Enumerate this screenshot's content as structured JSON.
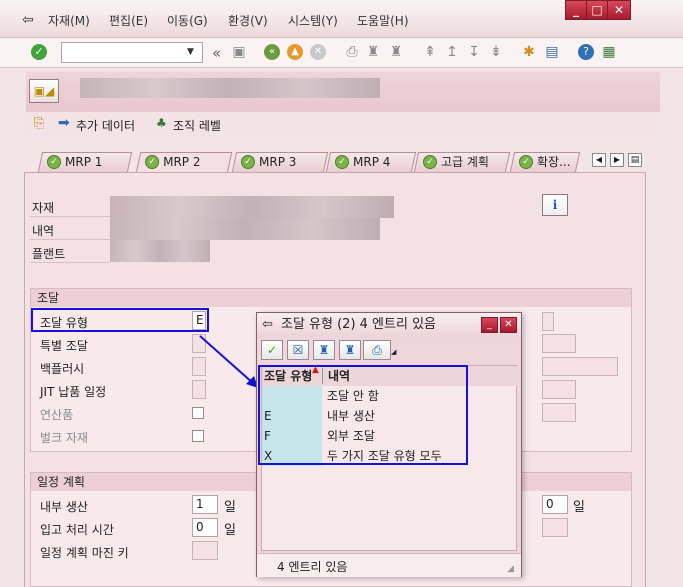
{
  "menubar": {
    "items": [
      "자재(M)",
      "편집(E)",
      "이동(G)",
      "환경(V)",
      "시스템(Y)",
      "도움말(H)"
    ]
  },
  "toolbar": {
    "command_field": "",
    "back_glyph": "«"
  },
  "subtoolbar": {
    "additional_data": "추가 데이터",
    "org_levels": "조직 레벨"
  },
  "tabs": [
    {
      "label": "MRP 1",
      "active": false
    },
    {
      "label": "MRP 2",
      "active": true
    },
    {
      "label": "MRP 3",
      "active": false
    },
    {
      "label": "MRP 4",
      "active": false
    },
    {
      "label": "고급 계획",
      "active": false
    },
    {
      "label": "확장...",
      "active": false
    }
  ],
  "header": {
    "material_label": "자재",
    "description_label": "내역",
    "plant_label": "플랜트"
  },
  "procurement": {
    "title": "조달",
    "procurement_type_label": "조달 유형",
    "procurement_type_value": "E",
    "special_procurement_label": "특별 조달",
    "backflush_label": "백플러시",
    "jit_label": "JIT 납품 일정",
    "coproduct_label": "연산품",
    "bulk_material_label": "벌크 자재"
  },
  "scheduling": {
    "title": "일정 계획",
    "inhouse_production_label": "내부 생산",
    "inhouse_production_value": "1",
    "inhouse_unit": "일",
    "gr_processing_label": "입고 처리 시간",
    "gr_processing_value": "0",
    "gr_unit": "일",
    "scheduling_margin_label": "일정 계획 마진 키",
    "right_value": "0",
    "right_unit": "일"
  },
  "popup": {
    "title": "조달 유형 (2)   4 엔트리 있음",
    "col_key": "조달 유형",
    "col_desc": "내역",
    "rows": [
      {
        "key": "",
        "desc": "조달 안 함"
      },
      {
        "key": "E",
        "desc": "내부 생산"
      },
      {
        "key": "F",
        "desc": "외부 조달"
      },
      {
        "key": "X",
        "desc": "두 가지 조달 유형 모두"
      }
    ],
    "status": "4 엔트리 있음"
  },
  "colors": {
    "highlight_box": "#1212d8",
    "key_cell": "#c6e5ea",
    "window_button": "#c02a3c"
  }
}
